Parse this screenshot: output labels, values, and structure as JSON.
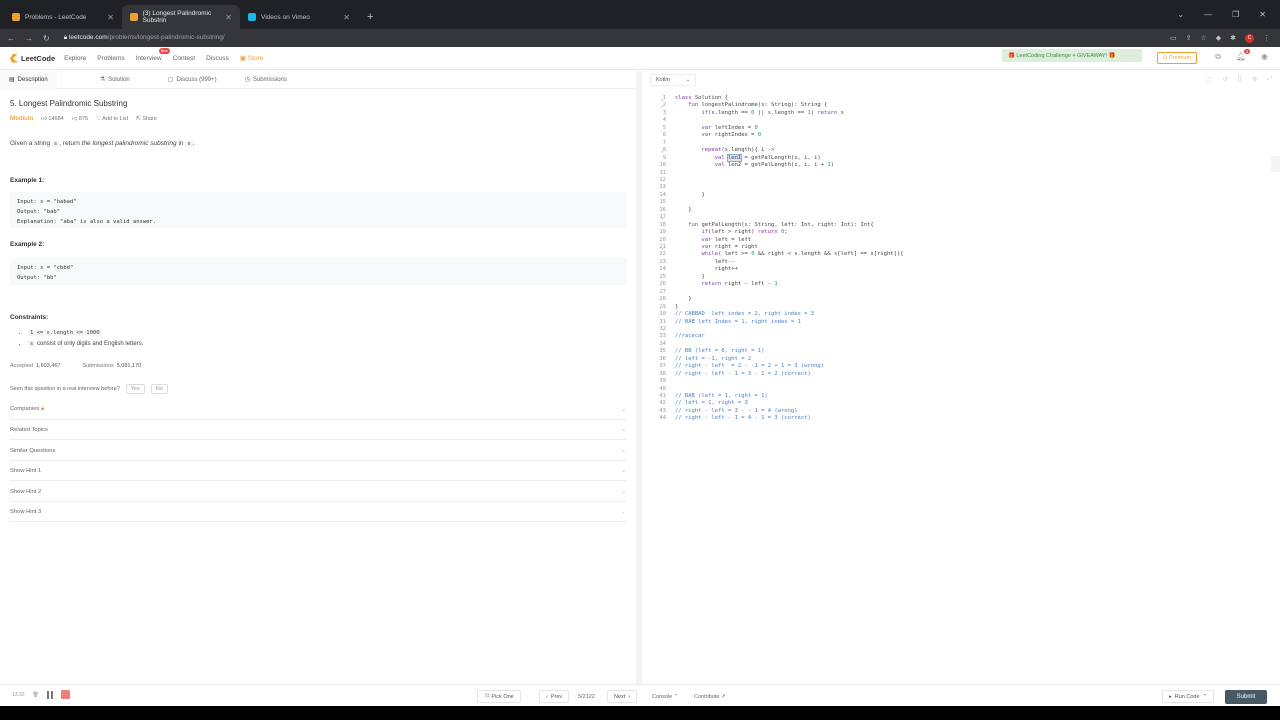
{
  "browser": {
    "tabs": [
      {
        "title": "Problems - LeetCode"
      },
      {
        "title": "(3) Longest Palindromic Substrin"
      },
      {
        "title": "Videos on Vimeo"
      }
    ],
    "url_host": "leetcode.com",
    "url_path": "/problems/longest-palindromic-substring/",
    "profile_initial": "C"
  },
  "nav": {
    "logo": "LeetCode",
    "items": [
      "Explore",
      "Problems",
      "Interview",
      "Contest",
      "Discuss",
      "Store"
    ],
    "interview_badge": "New",
    "challenge": "🎁 LeetCoding Challenge + GIVEAWAY! 🎁",
    "premium": "⊙ Premium",
    "notif_count": "3"
  },
  "tabs": [
    "Description",
    "Solution",
    "Discuss (999+)",
    "Submissions"
  ],
  "problem": {
    "title": "5. Longest Palindromic Substring",
    "difficulty": "Medium",
    "likes": "14684",
    "dislikes": "875",
    "add_to_list": "Add to List",
    "share": "Share",
    "desc_1": "Given a string ",
    "desc_s": "s",
    "desc_2": ", return ",
    "desc_em": "the longest palindromic substring",
    "desc_3": " in ",
    "desc_4": ".",
    "ex1_title": "Example 1:",
    "ex1_input": "Input: s = \"babad\"",
    "ex1_output": "Output: \"bab\"",
    "ex1_expl": "Explanation: \"aba\" is also a valid answer.",
    "ex2_title": "Example 2:",
    "ex2_input": "Input: s = \"cbbd\"",
    "ex2_output": "Output: \"bb\"",
    "constraints_title": "Constraints:",
    "c1": "1 <= s.length <= 1000",
    "c2_code": "s",
    "c2": " consist of only digits and English letters.",
    "accepted_label": "Accepted",
    "accepted": "1,603,467",
    "submissions_label": "Submissions",
    "submissions": "5,081,170",
    "seen": "Seen this question in a real interview before?",
    "yes": "Yes",
    "no": "No"
  },
  "accordions": [
    "Companies",
    "Related Topics",
    "Similar Questions",
    "Show Hint 1",
    "Show Hint 2",
    "Show Hint 3"
  ],
  "editor": {
    "language": "Kotlin",
    "lines": [
      "class Solution {",
      "    fun longestPalindrome(s: String): String {",
      "        if(s.length == 0 || s.length == 1) return s",
      "",
      "        var leftIndex = 0",
      "        var rightIndex = 0",
      "",
      "        repeat(s.length){ i ->",
      "            val len1 = getPalLength(s, i, i)",
      "            val len2 = getPalLength(s, i, i + 1)",
      "",
      "",
      "",
      "        }",
      "",
      "    }",
      "",
      "    fun getPalLength(s: String, left: Int, right: Int): Int{",
      "        if(left > right) return 0;",
      "        var left = left",
      "        var right = right",
      "        while( left >= 0 && right < s.length && s[left] == s[right]){",
      "            left--",
      "            right++",
      "        }",
      "        return right - left - 1",
      "",
      "    }",
      "}",
      "// CABBAD  left index = 2, right index = 3",
      "// BAB left Index = 1, right index = 1",
      "",
      "//racecar",
      "",
      "// BB (left = 0, right = 1)",
      "// left = -1, right = 2",
      "// right - left  = 2 - -1 = 2 + 1 = 3 (wrong)",
      "// right - left - 1 = 3 - 1 = 2 (correct)",
      "",
      "",
      "// BAB (left = 1, right = 1)",
      "// left = 1, right = 3",
      "// right - left = 3 - - 1 = 4 (wrong)",
      "// right - left - 1 = 4 - 1 = 3 (correct)"
    ]
  },
  "bottom": {
    "pick_one": "Pick One",
    "prev": "Prev",
    "page": "5/2122",
    "next": "Next",
    "console": "Console",
    "contribute": "Contribute",
    "run": "Run Code",
    "submit": "Submit",
    "rec_time": "13:32"
  }
}
